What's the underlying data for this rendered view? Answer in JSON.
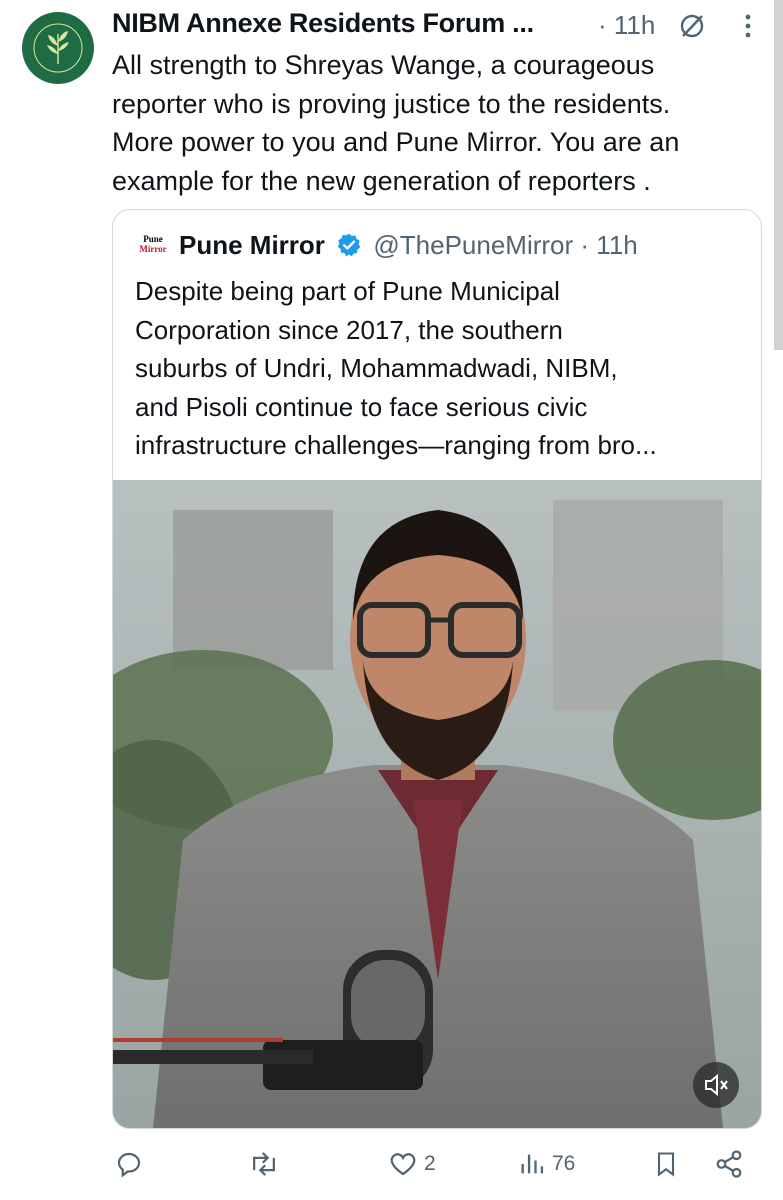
{
  "tweet": {
    "author": "NIBM Annexe Residents Forum ...",
    "time": "· 11h",
    "text": "All strength to Shreyas Wange, a courageous\nreporter who is proving justice to the residents.\nMore power to you and Pune Mirror. You are an\nexample for the new generation of reporters ."
  },
  "avatar_logo_text": "NIBM ANNEXE RESIDENTS FORUM",
  "quote": {
    "logo_text_top": "Pune",
    "logo_text_bottom": "Mirror",
    "name": "Pune Mirror",
    "handle": "@ThePuneMirror · 11h",
    "text": "Despite being part of Pune Municipal\nCorporation since 2017, the southern\nsuburbs of Undri, Mohammadwadi, NIBM,\nand Pisoli continue to face serious civic\ninfrastructure challenges—ranging from bro..."
  },
  "actions": {
    "reply_count": "",
    "retweet_count": "",
    "like_count": "2",
    "views_count": "76"
  },
  "icons": [
    "grok-icon",
    "more-icon",
    "verified-icon",
    "mute-icon",
    "reply-icon",
    "retweet-icon",
    "like-icon",
    "views-icon",
    "bookmark-icon",
    "share-icon"
  ],
  "colors": {
    "accent": "#1d9bf0",
    "muted": "#536471",
    "text": "#0f1419",
    "avatar_green": "#1f6b43"
  }
}
